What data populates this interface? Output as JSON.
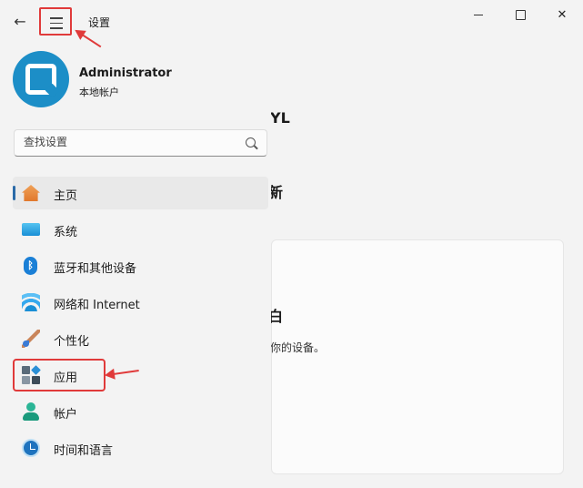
{
  "window": {
    "title": "设置",
    "back_icon": "arrow-left-icon",
    "menu_icon": "hamburger-icon",
    "controls": [
      "minimize",
      "maximize",
      "close"
    ],
    "close_glyph": "✕"
  },
  "user": {
    "name": "Administrator",
    "account_type": "本地帐户",
    "avatar_color": "#1c8ec7"
  },
  "search": {
    "placeholder": "查找设置",
    "value": ""
  },
  "nav": {
    "items": [
      {
        "label": "主页",
        "icon": "home-icon",
        "selected": true
      },
      {
        "label": "系统",
        "icon": "display-icon"
      },
      {
        "label": "蓝牙和其他设备",
        "icon": "bluetooth-icon"
      },
      {
        "label": "网络和 Internet",
        "icon": "wifi-icon"
      },
      {
        "label": "个性化",
        "icon": "brush-icon"
      },
      {
        "label": "应用",
        "icon": "apps-icon",
        "highlighted": true
      },
      {
        "label": "帐户",
        "icon": "user-icon"
      },
      {
        "label": "时间和语言",
        "icon": "clock-globe-icon"
      }
    ]
  },
  "content_peek": {
    "heading_fragment": "YL",
    "section_fragment": "新",
    "card_heading_fragment": "白",
    "card_text_fragment": "你的设备。"
  },
  "annotations": {
    "highlight_color": "#e03a3a",
    "accent_color": "#2a6aa8"
  }
}
